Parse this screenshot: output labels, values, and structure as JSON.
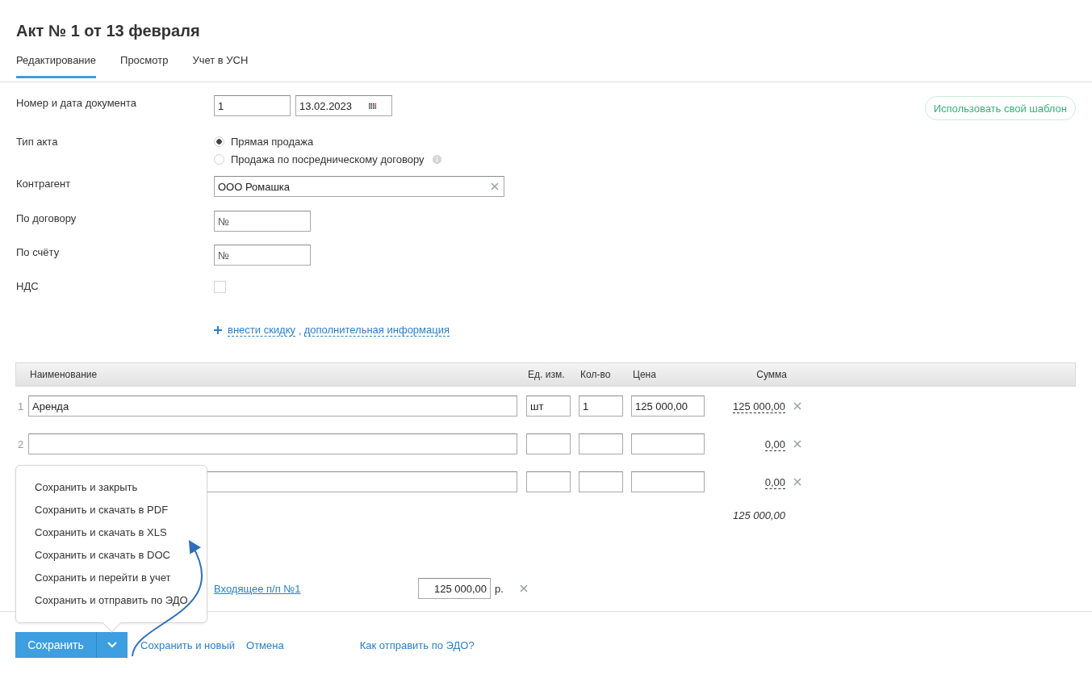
{
  "title": "Акт № 1 от 13 февраля",
  "tabs": [
    {
      "label": "Редактирование",
      "selected": true
    },
    {
      "label": "Просмотр",
      "selected": false
    },
    {
      "label": "Учет в УСН",
      "selected": false
    }
  ],
  "template_button": "Использовать свой шаблон",
  "form": {
    "document": {
      "label": "Номер и дата документа",
      "number": "1",
      "date": "13.02.2023"
    },
    "act_type": {
      "label": "Тип акта",
      "options": [
        {
          "label": "Прямая продажа",
          "selected": true
        },
        {
          "label": "Продажа по посредническому договору",
          "selected": false,
          "info": true
        }
      ]
    },
    "counterparty": {
      "label": "Контрагент",
      "value": "ООО Ромашка"
    },
    "contract": {
      "label": "По договору",
      "placeholder": "№"
    },
    "invoice": {
      "label": "По счёту",
      "placeholder": "№"
    },
    "vat": {
      "label": "НДС",
      "checked": false
    },
    "extra_links": {
      "links": [
        "внести скидку",
        "дополнительная информация"
      ],
      "separator": ","
    }
  },
  "table": {
    "columns": [
      "Наименование",
      "Ед. изм.",
      "Кол-во",
      "Цена",
      "Сумма"
    ],
    "rows": [
      {
        "number": "1",
        "name": "Аренда",
        "unit": "шт",
        "qty": "1",
        "price": "125 000,00",
        "sum": "125 000,00"
      },
      {
        "number": "2",
        "sum": "0,00"
      },
      {
        "sum": "0,00"
      }
    ],
    "total": "125 000,00"
  },
  "payment": {
    "link": "Входящее п/п №1",
    "amount": "125 000,00",
    "currency": "р."
  },
  "footer": {
    "save": "Сохранить",
    "links": [
      "Сохранить и новый",
      "Отмена"
    ],
    "help_link": "Как отправить по ЭДО?"
  },
  "save_menu": {
    "open": true,
    "items": [
      "Сохранить и закрыть",
      "Сохранить и скачать в PDF",
      "Сохранить и скачать в XLS",
      "Сохранить и скачать в DOC",
      "Сохранить и перейти в учет",
      "Сохранить и отправить по ЭДО"
    ]
  }
}
